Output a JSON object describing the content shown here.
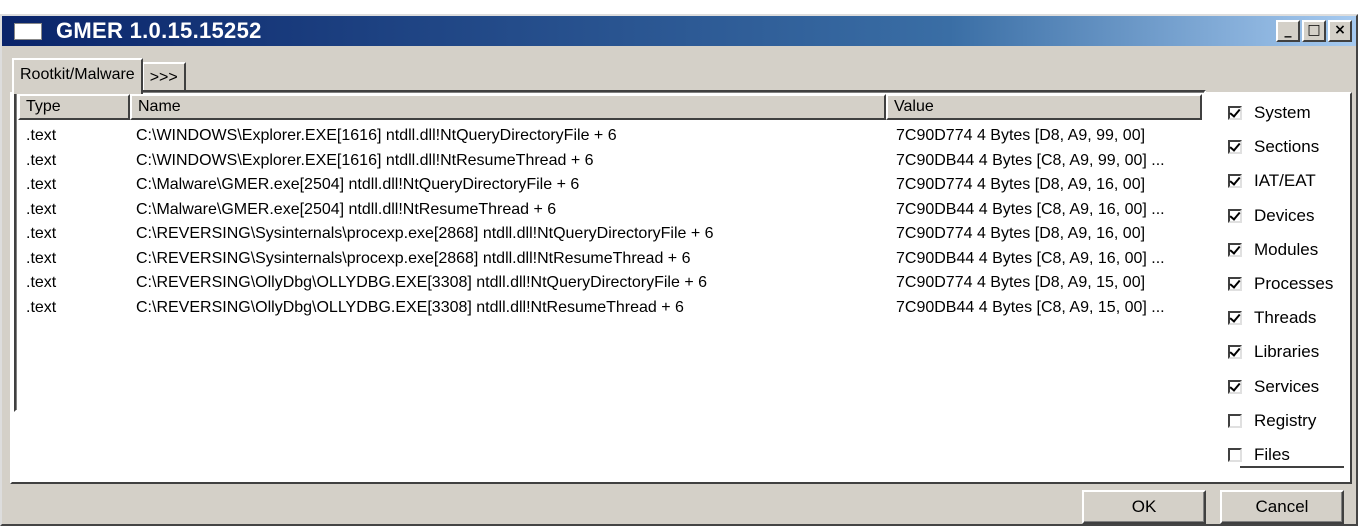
{
  "window": {
    "title": "GMER 1.0.15.15252",
    "controls": {
      "minimize": "_",
      "maximize": "□",
      "close": "×"
    }
  },
  "tabs": [
    {
      "label": "Rootkit/Malware"
    },
    {
      "label": ">>>"
    }
  ],
  "list": {
    "columns": [
      "Type",
      "Name",
      "Value"
    ],
    "rows": [
      {
        "type": ".text",
        "name": "C:\\WINDOWS\\Explorer.EXE[1616] ntdll.dll!NtQueryDirectoryFile + 6",
        "value": "7C90D774 4 Bytes  [D8, A9, 99, 00]"
      },
      {
        "type": ".text",
        "name": "C:\\WINDOWS\\Explorer.EXE[1616] ntdll.dll!NtResumeThread + 6",
        "value": "7C90DB44 4 Bytes  [C8, A9, 99, 00] ..."
      },
      {
        "type": ".text",
        "name": "C:\\Malware\\GMER.exe[2504] ntdll.dll!NtQueryDirectoryFile + 6",
        "value": "7C90D774 4 Bytes  [D8, A9, 16, 00]"
      },
      {
        "type": ".text",
        "name": "C:\\Malware\\GMER.exe[2504] ntdll.dll!NtResumeThread + 6",
        "value": "7C90DB44 4 Bytes  [C8, A9, 16, 00] ..."
      },
      {
        "type": ".text",
        "name": "C:\\REVERSING\\Sysinternals\\procexp.exe[2868] ntdll.dll!NtQueryDirectoryFile + 6",
        "value": "7C90D774 4 Bytes  [D8, A9, 16, 00]"
      },
      {
        "type": ".text",
        "name": "C:\\REVERSING\\Sysinternals\\procexp.exe[2868] ntdll.dll!NtResumeThread + 6",
        "value": "7C90DB44 4 Bytes  [C8, A9, 16, 00] ..."
      },
      {
        "type": ".text",
        "name": "C:\\REVERSING\\OllyDbg\\OLLYDBG.EXE[3308] ntdll.dll!NtQueryDirectoryFile + 6",
        "value": "7C90D774 4 Bytes  [D8, A9, 15, 00]"
      },
      {
        "type": ".text",
        "name": "C:\\REVERSING\\OllyDbg\\OLLYDBG.EXE[3308] ntdll.dll!NtResumeThread + 6",
        "value": "7C90DB44 4 Bytes  [C8, A9, 15, 00] ..."
      }
    ]
  },
  "options": [
    {
      "label": "System",
      "checked": true
    },
    {
      "label": "Sections",
      "checked": true
    },
    {
      "label": "IAT/EAT",
      "checked": true
    },
    {
      "label": "Devices",
      "checked": true
    },
    {
      "label": "Modules",
      "checked": true
    },
    {
      "label": "Processes",
      "checked": true
    },
    {
      "label": "Threads",
      "checked": true
    },
    {
      "label": "Libraries",
      "checked": true
    },
    {
      "label": "Services",
      "checked": true
    },
    {
      "label": "Registry",
      "checked": false
    },
    {
      "label": "Files",
      "checked": false
    }
  ],
  "buttons": {
    "ok": "OK",
    "cancel": "Cancel"
  }
}
